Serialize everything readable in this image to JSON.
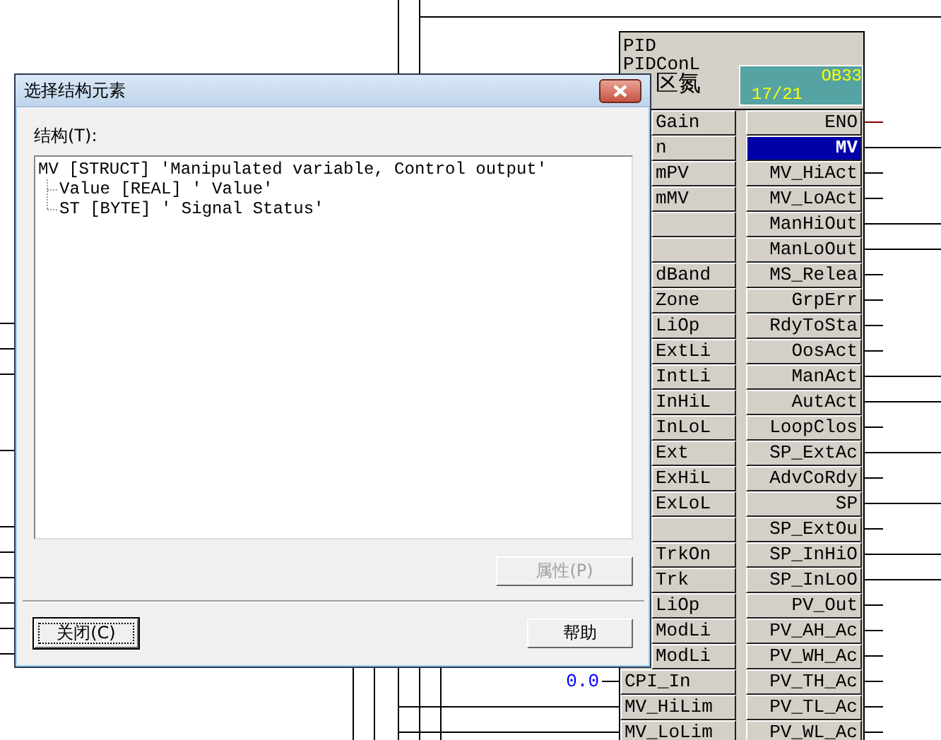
{
  "block": {
    "type_name": "PID",
    "instance_name": "PIDConL",
    "comment": "区氮",
    "comment_covered": true,
    "task": "OB33",
    "sequence": "17/21",
    "inputs": [
      {
        "label": "Gain",
        "covered": true
      },
      {
        "label": "n",
        "covered": true
      },
      {
        "label": "mPV",
        "covered": true
      },
      {
        "label": "mMV",
        "covered": true
      },
      {
        "covered": true
      },
      {
        "covered": true
      },
      {
        "label": "dBand",
        "covered": true
      },
      {
        "label": "Zone",
        "covered": true
      },
      {
        "label": "LiOp",
        "covered": true
      },
      {
        "label": "ExtLi",
        "covered": true
      },
      {
        "label": "IntLi",
        "covered": true
      },
      {
        "label": "InHiL",
        "covered": true
      },
      {
        "label": "InLoL",
        "covered": true
      },
      {
        "label": "Ext",
        "covered": true
      },
      {
        "label": "ExHiL",
        "covered": true
      },
      {
        "label": "ExLoL",
        "covered": true
      },
      {
        "covered": true
      },
      {
        "label": "TrkOn",
        "covered": true
      },
      {
        "label": "Trk",
        "covered": true
      },
      {
        "label": "LiOp",
        "covered": true
      },
      {
        "label": "ModLi",
        "covered": true
      },
      {
        "label": "ModLi",
        "covered": true
      },
      {
        "label": "CPI_In",
        "covered": false,
        "long_wire": false,
        "value": "0.0"
      },
      {
        "label": "MV_HiLim",
        "covered": false,
        "long_wire": true
      },
      {
        "label": "MV_LoLim",
        "covered": false,
        "long_wire": true
      }
    ],
    "outputs": [
      {
        "label": "ENO",
        "kind": "enable",
        "selected": false,
        "long_wire": false
      },
      {
        "label": "MV",
        "kind": "pin",
        "selected": true,
        "long_wire": true
      },
      {
        "label": "MV_HiAct",
        "kind": "pin",
        "selected": false,
        "long_wire": false
      },
      {
        "label": "MV_LoAct",
        "kind": "pin",
        "selected": false,
        "long_wire": false
      },
      {
        "label": "ManHiOut",
        "kind": "pin",
        "selected": false,
        "long_wire": true
      },
      {
        "label": "ManLoOut",
        "kind": "pin",
        "selected": false,
        "long_wire": true
      },
      {
        "label": "MS_Relea",
        "kind": "pin",
        "selected": false,
        "long_wire": false
      },
      {
        "label": "GrpErr",
        "kind": "pin",
        "selected": false,
        "long_wire": false
      },
      {
        "label": "RdyToSta",
        "kind": "pin",
        "selected": false,
        "long_wire": false
      },
      {
        "label": "OosAct",
        "kind": "pin",
        "selected": false,
        "long_wire": false
      },
      {
        "label": "ManAct",
        "kind": "pin",
        "selected": false,
        "long_wire": true
      },
      {
        "label": "AutAct",
        "kind": "pin",
        "selected": false,
        "long_wire": true
      },
      {
        "label": "LoopClos",
        "kind": "pin",
        "selected": false,
        "long_wire": false
      },
      {
        "label": "SP_ExtAc",
        "kind": "pin",
        "selected": false,
        "long_wire": true
      },
      {
        "label": "AdvCoRdy",
        "kind": "pin",
        "selected": false,
        "long_wire": false
      },
      {
        "label": "SP",
        "kind": "pin",
        "selected": false,
        "long_wire": true
      },
      {
        "label": "SP_ExtOu",
        "kind": "pin",
        "selected": false,
        "long_wire": false
      },
      {
        "label": "SP_InHiO",
        "kind": "pin",
        "selected": false,
        "long_wire": true
      },
      {
        "label": "SP_InLoO",
        "kind": "pin",
        "selected": false,
        "long_wire": true
      },
      {
        "label": "PV_Out",
        "kind": "pin",
        "selected": false,
        "long_wire": false
      },
      {
        "label": "PV_AH_Ac",
        "kind": "pin",
        "selected": false,
        "long_wire": false
      },
      {
        "label": "PV_WH_Ac",
        "kind": "pin",
        "selected": false,
        "long_wire": false
      },
      {
        "label": "PV_TH_Ac",
        "kind": "pin",
        "selected": false,
        "long_wire": false
      },
      {
        "label": "PV_TL_Ac",
        "kind": "pin",
        "selected": false,
        "long_wire": false
      },
      {
        "label": "PV_WL_Ac",
        "kind": "pin",
        "selected": false,
        "long_wire": false
      }
    ]
  },
  "dialog": {
    "title": "选择结构元素",
    "list_label": "结构(T):",
    "tree": [
      {
        "label": "MV [STRUCT] 'Manipulated variable, Control output'",
        "children": [
          {
            "label": "Value [REAL] ' Value'"
          },
          {
            "label": "ST [BYTE] ' Signal Status'"
          }
        ]
      }
    ],
    "properties_button": {
      "label": "属性(P)",
      "disabled": true
    },
    "close_button": {
      "label": "关闭(C)",
      "focused": true
    },
    "help_button": {
      "label": "帮助",
      "focused": false
    }
  }
}
